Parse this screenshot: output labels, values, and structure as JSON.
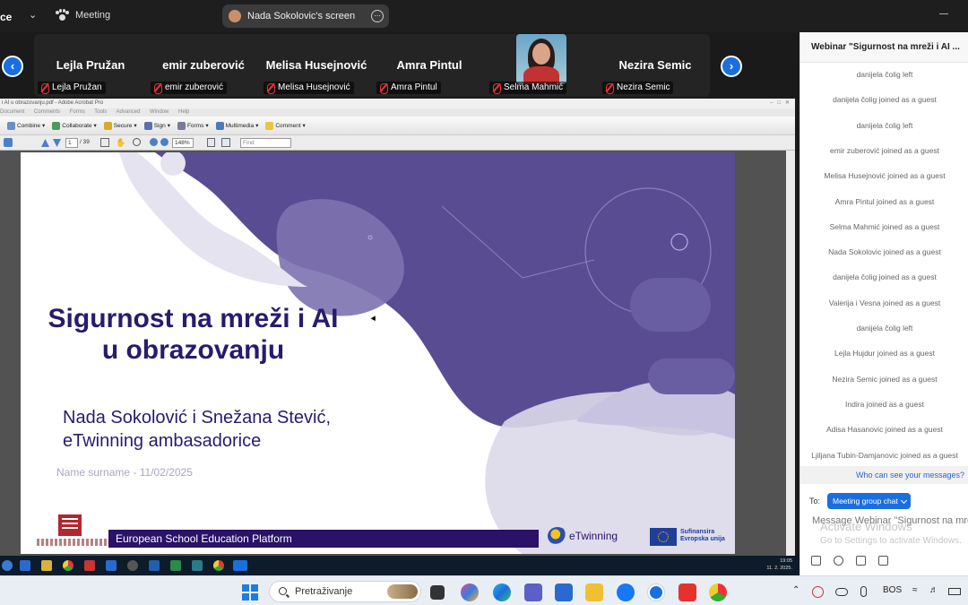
{
  "topbar": {
    "left_fragment": "ce",
    "meeting_label": "Meeting",
    "screen_share_label": "Nada Sokolovic's screen"
  },
  "participants": [
    {
      "display": "Lejla Pružan",
      "name": "Lejla Pružan"
    },
    {
      "display": "emir zuberović",
      "name": "emir zuberović"
    },
    {
      "display": "Melisa Husejnović",
      "name": "Melisa Husejnović"
    },
    {
      "display": "Amra Pintul",
      "name": "Amra Pintul"
    },
    {
      "display": "",
      "name": "Selma Mahmić"
    },
    {
      "display": "Nezira Semic",
      "name": "Nezira Semic"
    }
  ],
  "acrobat": {
    "title": "i AI u obrazovanju.pdf - Adobe Acrobat Pro",
    "menu": [
      "Document",
      "Comments",
      "Forms",
      "Tools",
      "Advanced",
      "Window",
      "Help"
    ],
    "toolbar": [
      "Combine",
      "Collaborate",
      "Secure",
      "Sign",
      "Forms",
      "Multimedia",
      "Comment"
    ],
    "page_current": "1",
    "page_total": "/ 39",
    "zoom": "148%",
    "find_placeholder": "Find"
  },
  "slide": {
    "title": "Sigurnost na mreži i AI u obrazovanju",
    "authors_line1": "Nada Sokolović i Snežana Stević,",
    "authors_line2": "eTwinning ambasadorice",
    "date_line": "Name surname - 11/02/2025",
    "band_text": "European School Education Platform",
    "etwinning": "eTwinning",
    "eu_line1": "Sufinansira",
    "eu_line2": "Evropska unija",
    "colors": {
      "primary": "#2a1a6e",
      "shape": "#5a4c93",
      "light": "#dcd9ea"
    }
  },
  "remote_clock": {
    "time": "19:05",
    "date": "11. 2. 2025."
  },
  "chat": {
    "header": "Webinar \"Sigurnost na mreži i AI ...",
    "messages": [
      "danijela čolig left",
      "danijela čolig joined as a guest",
      "danijela čolig left",
      "emir zuberović joined as a guest",
      "Melisa Husejnović joined as a guest",
      "Amra Pintul joined as a guest",
      "Selma Mahmić joined as a guest",
      "Nada Sokolovic joined as a guest",
      "danijela čolig joined as a guest",
      "Valerija i Vesna joined as a guest",
      "danijela čolig left",
      "Lejla Hujdur joined as a guest",
      "Nezira Semic joined as a guest",
      "Indira joined as a guest",
      "Adisa Hasanovic joined as a guest",
      "Ljiljana Tubin-Damjanovic joined as a guest"
    ],
    "who_can_see": "Who can see your messages?",
    "to_label": "To:",
    "recipient": "Meeting group chat",
    "input_placeholder": "Message Webinar \"Sigurnost na mreži i AI u obrazovanju\"",
    "watermark_line1": "Activate Windows",
    "watermark_line2": "Go to Settings to activate Windows."
  },
  "taskbar": {
    "search_placeholder": "Pretraživanje",
    "language": "BOS",
    "accent": "#1a6fe0"
  }
}
